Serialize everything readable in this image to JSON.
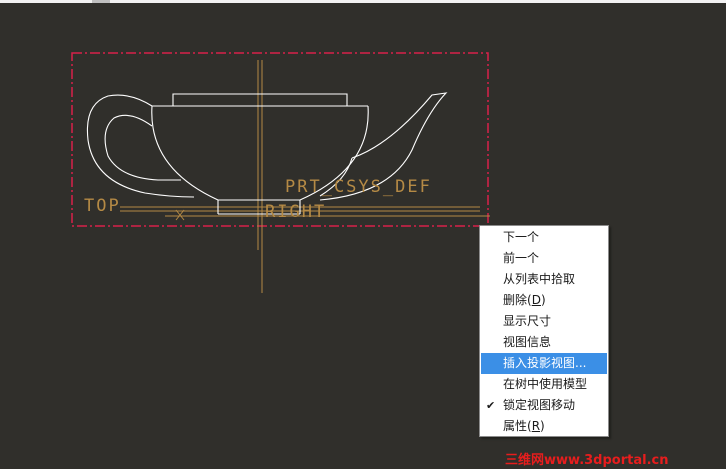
{
  "canvas": {
    "labels": {
      "csys": "PRT_CSYS_DEF",
      "top": "TOP",
      "right": "RIGHT"
    },
    "colors": {
      "background": "#302f2b",
      "model_edges": "#ffffff",
      "datum_lines": "#b58a45",
      "selection_box": "#d8204a"
    }
  },
  "context_menu": {
    "items": [
      {
        "label": "下一个"
      },
      {
        "label": "前一个"
      },
      {
        "label": "从列表中拾取"
      },
      {
        "label": "删除",
        "hotkey": "D"
      },
      {
        "label": "显示尺寸"
      },
      {
        "label": "视图信息"
      },
      {
        "label": "插入投影视图..."
      },
      {
        "label": "在树中使用模型"
      },
      {
        "label": "锁定视图移动",
        "checked": true
      },
      {
        "label": "属性",
        "hotkey": "R"
      }
    ],
    "highlight_color": "#3b8fe6"
  },
  "watermark": {
    "text": "三维网www.3dportal.cn"
  }
}
